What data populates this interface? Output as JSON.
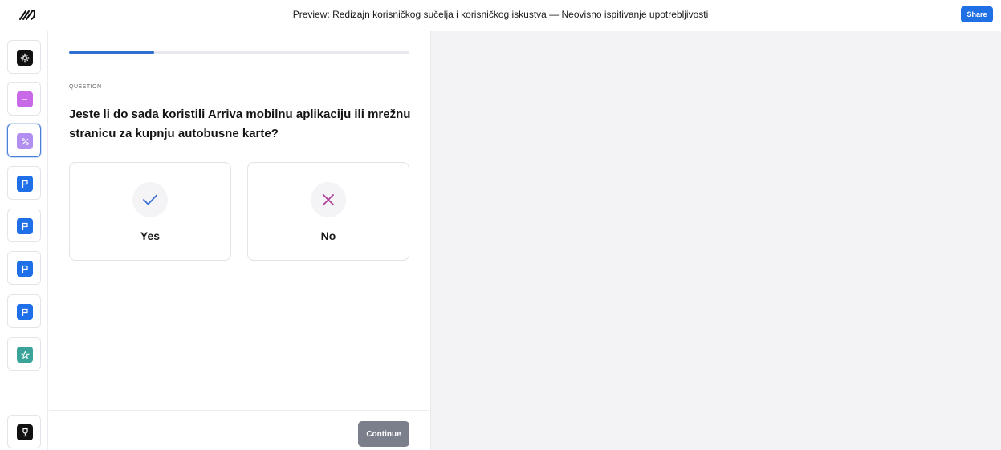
{
  "header": {
    "title": "Preview: Redizajn korisničkog sučelja i korisničkog iskustva — Neovisno ispitivanje upotrebljivosti",
    "share_label": "Share"
  },
  "sidebar": {
    "items": [
      {
        "icon": "settings-icon",
        "color": "#111111"
      },
      {
        "icon": "text-block-icon",
        "color": "#c86ae8"
      },
      {
        "icon": "percent-icon",
        "color": "#b18ef0",
        "active": true
      },
      {
        "icon": "flag-icon",
        "color": "#1e6fe8"
      },
      {
        "icon": "flag-icon",
        "color": "#1e6fe8"
      },
      {
        "icon": "flag-icon",
        "color": "#1e6fe8"
      },
      {
        "icon": "flag-icon",
        "color": "#1e6fe8"
      },
      {
        "icon": "star-icon",
        "color": "#3aa39a"
      },
      {
        "icon": "trophy-icon",
        "color": "#111111"
      }
    ]
  },
  "main": {
    "progress": 0.25,
    "question_label": "QUESTION",
    "question_text": "Jeste li do sada koristili Arriva mobilnu aplikaciju ili mrežnu stranicu za kupnju autobusne karte?",
    "options": [
      {
        "label": "Yes",
        "icon": "check-icon",
        "color": "#3b6fd6"
      },
      {
        "label": "No",
        "icon": "x-icon",
        "color": "#b0409b"
      }
    ],
    "continue_label": "Continue"
  }
}
